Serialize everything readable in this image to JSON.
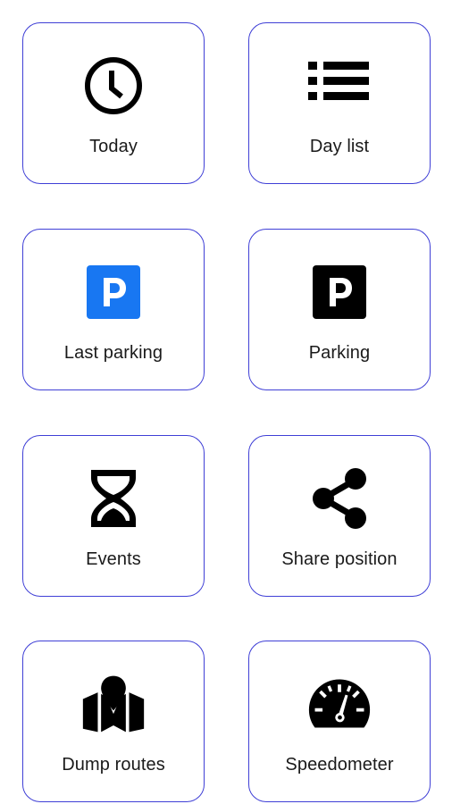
{
  "tiles": [
    {
      "label": "Today",
      "icon": "clock-icon"
    },
    {
      "label": "Day list",
      "icon": "list-icon"
    },
    {
      "label": "Last parking",
      "icon": "parking-blue-icon"
    },
    {
      "label": "Parking",
      "icon": "parking-icon"
    },
    {
      "label": "Events",
      "icon": "hourglass-icon"
    },
    {
      "label": "Share position",
      "icon": "share-icon"
    },
    {
      "label": "Dump routes",
      "icon": "map-pin-icon"
    },
    {
      "label": "Speedometer",
      "icon": "speedometer-icon"
    }
  ],
  "colors": {
    "tile_border": "#3f3fd6",
    "parking_blue": "#1877f2",
    "icon_black": "#000000"
  }
}
